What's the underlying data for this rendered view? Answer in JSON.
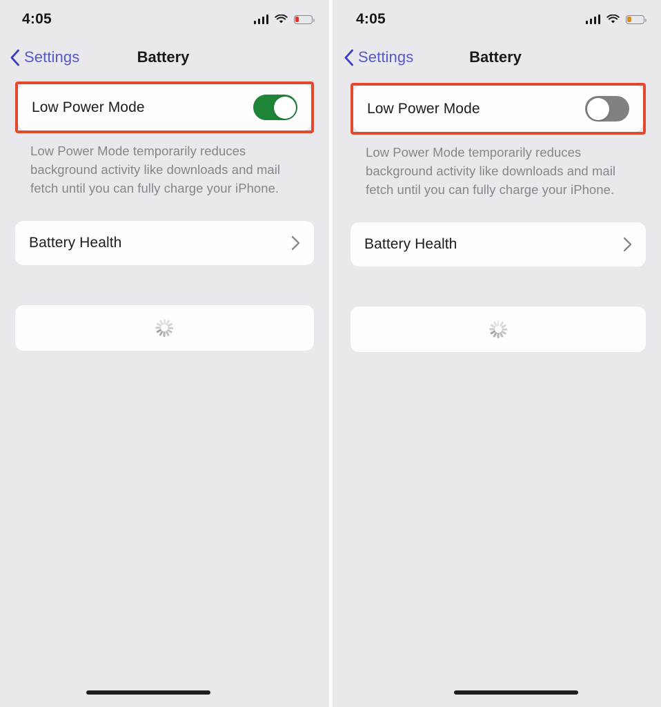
{
  "colors": {
    "page_background": "#ffffff",
    "screen_background": "#e9e8ec",
    "card_background": "#fdfdfd",
    "annotation_border": "#e2492b",
    "toggle_on_green": "#1e8438",
    "toggle_off_gray": "#808085",
    "link_blue": "#5659c9",
    "footnote_gray": "#85858a",
    "battery_low_red": "#e0342c",
    "battery_low_orange": "#e08a22"
  },
  "panels": [
    {
      "id": "before",
      "status_bar": {
        "time": "4:05",
        "signal_icon": "cellular-signal-icon",
        "signal_bars": 4,
        "wifi_icon": "wifi-icon",
        "battery_icon": "battery-low-icon",
        "battery_fill_percent": 18,
        "battery_fill_color": "#e0342c"
      },
      "nav_bar": {
        "back_icon": "chevron-left-icon",
        "back_label": "Settings",
        "title": "Battery"
      },
      "low_power_row": {
        "label": "Low Power Mode",
        "toggle_state": "on",
        "toggle_name": "low-power-mode-toggle",
        "highlighted": true
      },
      "footnote": "Low Power Mode temporarily reduces background activity like downloads and mail fetch until you can fully charge your iPhone.",
      "battery_health_row": {
        "label": "Battery Health",
        "disclosure_icon": "chevron-right-icon"
      },
      "loading_card": {
        "spinner_icon": "activity-spinner-icon"
      },
      "home_indicator": "home-indicator-bar"
    },
    {
      "id": "after",
      "status_bar": {
        "time": "4:05",
        "signal_icon": "cellular-signal-icon",
        "signal_bars": 4,
        "wifi_icon": "wifi-icon",
        "battery_icon": "battery-low-power-icon",
        "battery_fill_percent": 24,
        "battery_fill_color": "#e08a22"
      },
      "nav_bar": {
        "back_icon": "chevron-left-icon",
        "back_label": "Settings",
        "title": "Battery"
      },
      "low_power_row": {
        "label": "Low Power Mode",
        "toggle_state": "off",
        "toggle_name": "low-power-mode-toggle",
        "highlighted": true
      },
      "footnote": "Low Power Mode temporarily reduces background activity like downloads and mail fetch until you can fully charge your iPhone.",
      "battery_health_row": {
        "label": "Battery Health",
        "disclosure_icon": "chevron-right-icon"
      },
      "loading_card": {
        "spinner_icon": "activity-spinner-icon"
      },
      "home_indicator": "home-indicator-bar"
    }
  ]
}
